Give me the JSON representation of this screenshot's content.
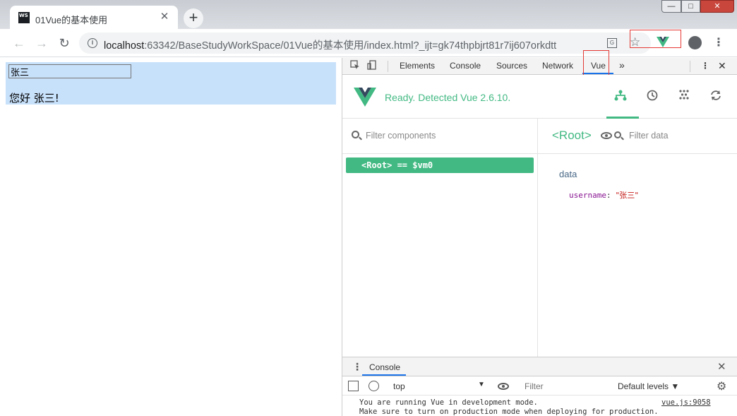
{
  "window": {
    "minimize_glyph": "—",
    "maximize_glyph": "□",
    "close_glyph": "✕"
  },
  "tab": {
    "favicon": "WS",
    "title": "01Vue的基本使用",
    "close_glyph": "✕"
  },
  "newtab_glyph": "+",
  "toolbar": {
    "back_glyph": "←",
    "forward_glyph": "→",
    "reload_glyph": "↻",
    "url_host": "localhost",
    "url_rest": ":63342/BaseStudyWorkSpace/01Vue的基本使用/index.html?_ijt=gk74thpbjrt81r7ij607orkdtt",
    "info_glyph": "i",
    "star_glyph": "☆",
    "menu_glyph": "⋮",
    "translate_glyph": "G"
  },
  "page": {
    "input_value": "张三",
    "greeting": "您好 张三!"
  },
  "devtools": {
    "tabs": [
      "Elements",
      "Console",
      "Sources",
      "Network",
      "Vue"
    ],
    "more_glyph": "»",
    "kebab_glyph": "⋮",
    "close_glyph": "✕",
    "vue": {
      "ready_text": "Ready. Detected Vue 2.6.10.",
      "components_filter_placeholder": "Filter components",
      "root_row": "<Root> == $vm0",
      "selected_component": "<Root>",
      "data_filter_placeholder": "Filter data",
      "data_section": "data",
      "props": [
        {
          "key": "username",
          "value": "\"张三\""
        }
      ]
    },
    "console": {
      "drawer_tab": "Console",
      "context": "top",
      "filter_placeholder": "Filter",
      "levels": "Default levels ▼",
      "messages": [
        "You are running Vue in development mode.",
        "Make sure to turn on production mode when deploying for production."
      ],
      "source": "vue.js:9058"
    }
  },
  "colors": {
    "vue_green": "#42b983",
    "highlight": "#c8e1fb",
    "annotation_red": "#e53935"
  }
}
